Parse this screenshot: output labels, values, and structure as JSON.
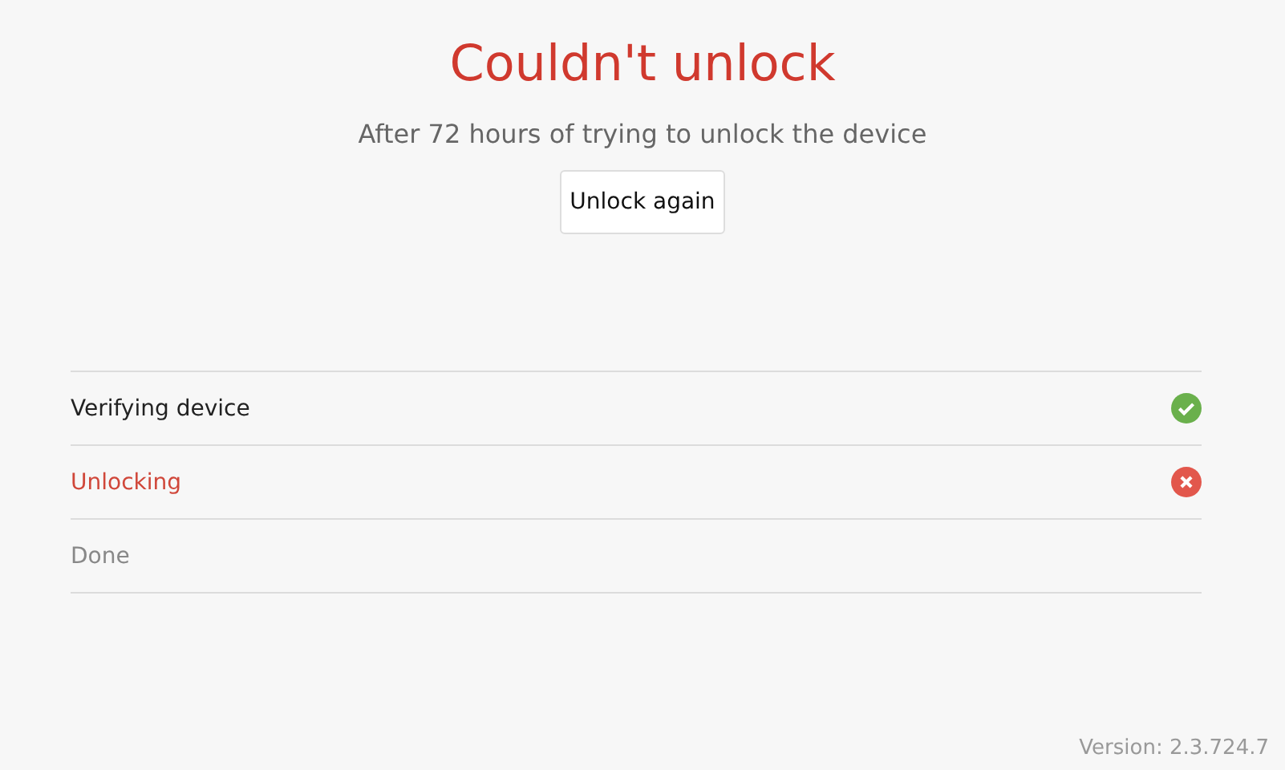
{
  "title": "Couldn't unlock",
  "subtitle": "After 72 hours of trying to unlock the device",
  "button": "Unlock again",
  "steps": [
    {
      "label": "Verifying device",
      "kind": "success"
    },
    {
      "label": "Unlocking",
      "kind": "failed"
    },
    {
      "label": "Done",
      "kind": "pending"
    }
  ],
  "version": "Version: 2.3.724.7"
}
